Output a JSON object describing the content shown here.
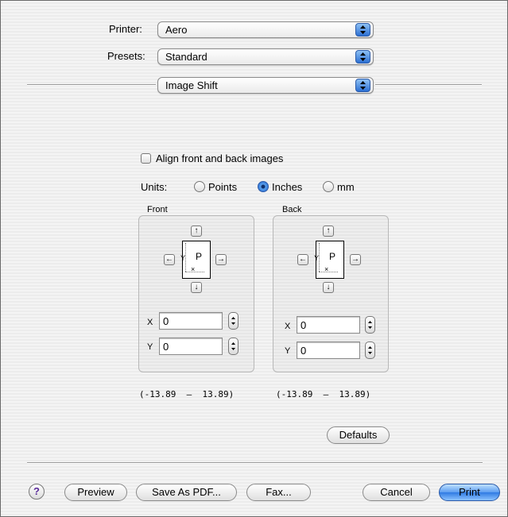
{
  "printer": {
    "label": "Printer:",
    "value": "Aero"
  },
  "presets": {
    "label": "Presets:",
    "value": "Standard"
  },
  "panel": {
    "value": "Image Shift"
  },
  "align": {
    "label": "Align front and back images",
    "checked": false
  },
  "units": {
    "label": "Units:",
    "options": [
      "Points",
      "Inches",
      "mm"
    ],
    "selected": "Inches"
  },
  "front": {
    "title": "Front",
    "page_letter": "P",
    "x_label": "X",
    "x_value": "0",
    "y_label": "Y",
    "y_value": "0",
    "range": "(-13.89  —  13.89)"
  },
  "back": {
    "title": "Back",
    "page_letter": "P",
    "x_label": "X",
    "x_value": "0",
    "y_label": "Y",
    "y_value": "0",
    "range": "(-13.89  —  13.89)"
  },
  "icons": {
    "up": "↑",
    "down": "↓",
    "left": "←",
    "right": "→",
    "axis_y": "Y",
    "axis_x": "×"
  },
  "buttons": {
    "defaults": "Defaults",
    "help": "?",
    "preview": "Preview",
    "save_pdf": "Save As PDF...",
    "fax": "Fax...",
    "cancel": "Cancel",
    "print": "Print"
  }
}
